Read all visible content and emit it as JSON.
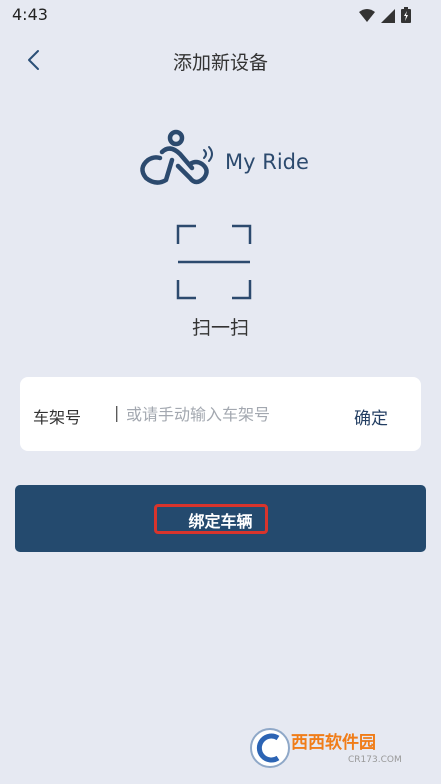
{
  "status_bar": {
    "time": "4:43"
  },
  "header": {
    "back_icon": "chevron-left-icon",
    "title": "添加新设备"
  },
  "logo": {
    "icon": "bicycle-wifi-icon",
    "text": "My Ride"
  },
  "scan": {
    "icon": "scan-frame-icon",
    "label": "扫一扫"
  },
  "vin_form": {
    "label": "车架号",
    "separator": "|",
    "placeholder": "或请手动输入车架号",
    "value": "",
    "confirm_label": "确定"
  },
  "bind_button": {
    "label": "绑定车辆",
    "highlight_color": "#d8342c"
  },
  "watermark": {
    "text": "西西软件园",
    "sub": "CR173.COM"
  },
  "colors": {
    "background": "#e6e9f2",
    "primary": "#244a6e",
    "card": "#ffffff"
  }
}
